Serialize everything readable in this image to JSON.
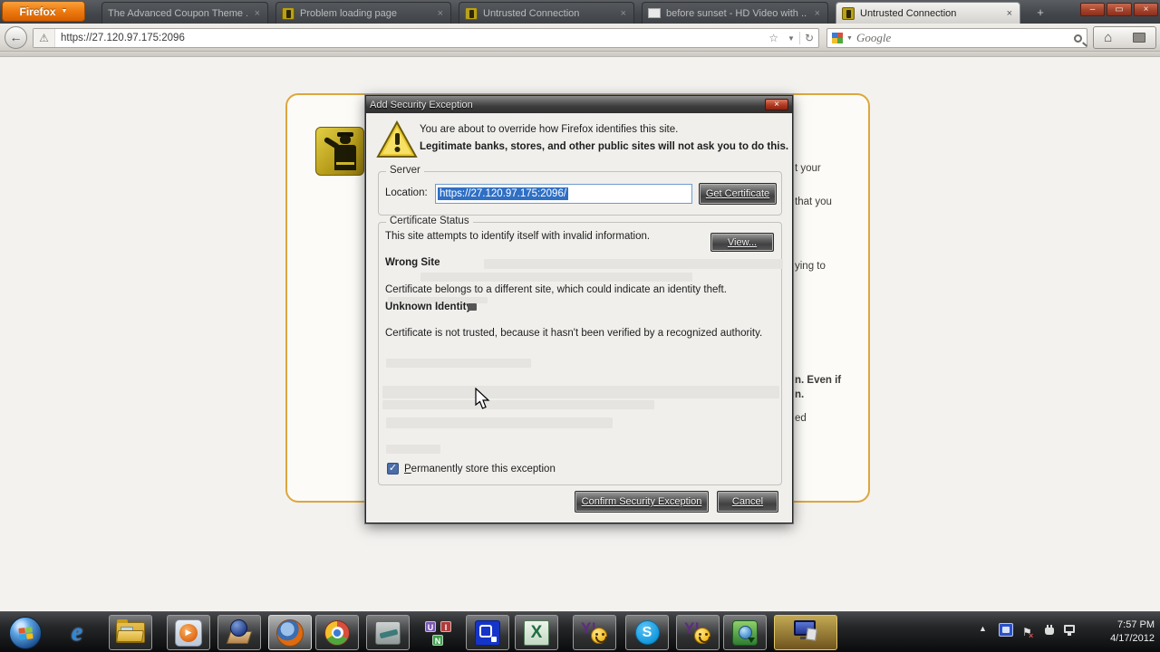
{
  "browser": {
    "firefox_button_label": "Firefox",
    "tabs": [
      {
        "label": "The Advanced Coupon Theme ...",
        "active": false
      },
      {
        "label": "Problem loading page",
        "active": false
      },
      {
        "label": "Untrusted Connection",
        "active": false
      },
      {
        "label": "before sunset - HD Video with ...",
        "active": false
      },
      {
        "label": "Untrusted Connection",
        "active": true
      }
    ],
    "urlbar_value": "https://27.120.97.175:2096",
    "search_placeholder": "Google"
  },
  "page": {
    "fragments": [
      "t your",
      "that you",
      "ying to",
      "n. Even if",
      "n.",
      "ed"
    ]
  },
  "dialog": {
    "title": "Add Security Exception",
    "intro_line1": "You are about to override how Firefox identifies this site.",
    "intro_line2": "Legitimate banks, stores, and other public sites will not ask you to do this.",
    "server_legend": "Server",
    "location_label": "Location:",
    "location_value": "https://27.120.97.175:2096/",
    "get_certificate_label": "Get Certificate",
    "cert_status_legend": "Certificate Status",
    "status_line": "This site attempts to identify itself with invalid information.",
    "view_label": "View...",
    "wrong_site_heading": "Wrong Site",
    "wrong_site_text": "Certificate belongs to a different site, which could indicate an identity theft.",
    "unknown_identity_heading": "Unknown Identity",
    "unknown_identity_text": "Certificate is not trusted, because it hasn't been verified by a recognized authority.",
    "checkbox_accesskey": "P",
    "checkbox_label_rest": "ermanently store this exception",
    "confirm_label": "Confirm Security Exception",
    "cancel_label": "Cancel"
  },
  "taskbar": {
    "ie_letter": "e",
    "media_play_glyph": "▶",
    "uin_letters": [
      "U",
      "I",
      "N"
    ],
    "excel_letter": "X",
    "skype_letter": "S",
    "yahoo_label": "Y!",
    "clock_time": "7:57 PM",
    "clock_date": "4/17/2012"
  },
  "icons": {
    "firefox_dropdown": "▼",
    "back": "←",
    "warning": "⚠",
    "star": "☆",
    "url_dropdown": "▼",
    "reload": "↻",
    "search_dropdown": "▼",
    "home": "⌂",
    "new_tab": "+",
    "tab_close": "×",
    "minimize": "–",
    "maximize": "▭",
    "close": "×",
    "dialog_close": "×",
    "checkbox_check": "✓",
    "tray_up": "▲",
    "tray_flag": "⚑",
    "tray_flag_x": "×"
  },
  "colors": {
    "accent_orange": "#ef7d12",
    "warning_yellow": "#d8bc2a",
    "selection_blue": "#2f6fc4",
    "page_border_gold": "#dca73d"
  }
}
